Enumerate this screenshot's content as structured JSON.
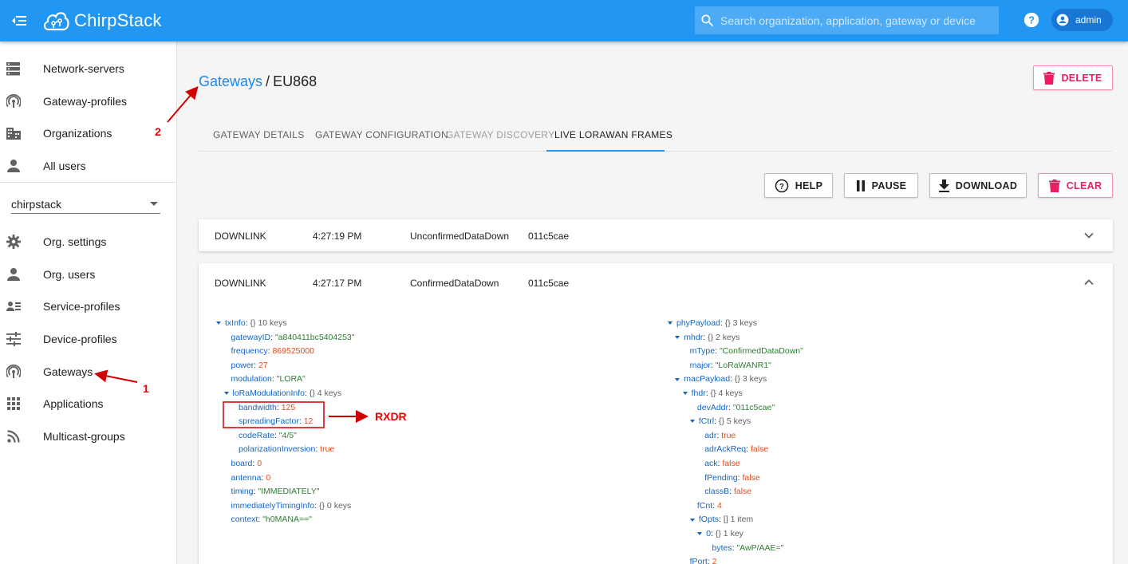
{
  "header": {
    "app_name": "ChirpStack",
    "search_placeholder": "Search organization, application, gateway or device",
    "user": "admin"
  },
  "sidebar": {
    "admin_items": [
      {
        "label": "Network-servers",
        "icon": "server-icon"
      },
      {
        "label": "Gateway-profiles",
        "icon": "antenna-icon"
      },
      {
        "label": "Organizations",
        "icon": "building-icon"
      },
      {
        "label": "All users",
        "icon": "person-icon"
      }
    ],
    "org_selected": "chirpstack",
    "org_items": [
      {
        "label": "Org. settings",
        "icon": "gear-icon"
      },
      {
        "label": "Org. users",
        "icon": "person-icon"
      },
      {
        "label": "Service-profiles",
        "icon": "account-details-icon"
      },
      {
        "label": "Device-profiles",
        "icon": "tune-icon"
      },
      {
        "label": "Gateways",
        "icon": "antenna-icon"
      },
      {
        "label": "Applications",
        "icon": "apps-grid-icon"
      },
      {
        "label": "Multicast-groups",
        "icon": "rss-icon"
      }
    ]
  },
  "breadcrumb": {
    "link": "Gateways",
    "separator": "/",
    "current": "EU868"
  },
  "actions": {
    "delete": "DELETE",
    "help": "HELP",
    "pause": "PAUSE",
    "download": "DOWNLOAD",
    "clear": "CLEAR"
  },
  "tabs": [
    "GATEWAY DETAILS",
    "GATEWAY CONFIGURATION",
    "GATEWAY DISCOVERY",
    "LIVE LORAWAN FRAMES"
  ],
  "active_tab": "LIVE LORAWAN FRAMES",
  "frames": [
    {
      "direction": "DOWNLINK",
      "time": "4:27:19 PM",
      "type": "UnconfirmedDataDown",
      "devaddr": "011c5cae"
    },
    {
      "direction": "DOWNLINK",
      "time": "4:27:17 PM",
      "type": "ConfirmedDataDown",
      "devaddr": "011c5cae"
    }
  ],
  "tree_left": [
    {
      "d": 0,
      "exp": true,
      "k": "txInfo",
      "m": "{}  10 keys"
    },
    {
      "d": 1,
      "k": "gatewayID",
      "v": "\"a840411bc5404253\"",
      "t": "str"
    },
    {
      "d": 1,
      "k": "frequency",
      "v": "869525000",
      "t": "num"
    },
    {
      "d": 1,
      "k": "power",
      "v": "27",
      "t": "num"
    },
    {
      "d": 1,
      "k": "modulation",
      "v": "\"LORA\"",
      "t": "str"
    },
    {
      "d": 1,
      "exp": true,
      "k": "loRaModulationInfo",
      "m": "{}  4 keys"
    },
    {
      "d": 2,
      "k": "bandwidth",
      "v": "125",
      "t": "num"
    },
    {
      "d": 2,
      "k": "spreadingFactor",
      "v": "12",
      "t": "num"
    },
    {
      "d": 2,
      "k": "codeRate",
      "v": "\"4/5\"",
      "t": "str"
    },
    {
      "d": 2,
      "k": "polarizationInversion",
      "v": "true",
      "t": "bool"
    },
    {
      "d": 1,
      "k": "board",
      "v": "0",
      "t": "num"
    },
    {
      "d": 1,
      "k": "antenna",
      "v": "0",
      "t": "num"
    },
    {
      "d": 1,
      "k": "timing",
      "v": "\"IMMEDIATELY\"",
      "t": "str"
    },
    {
      "d": 1,
      "k": "immediatelyTimingInfo",
      "m": "{}  0 keys"
    },
    {
      "d": 1,
      "k": "context",
      "v": "\"h0MANA==\"",
      "t": "str"
    }
  ],
  "tree_right": [
    {
      "d": 0,
      "exp": true,
      "k": "phyPayload",
      "m": "{}  3 keys"
    },
    {
      "d": 1,
      "exp": true,
      "k": "mhdr",
      "m": "{}  2 keys"
    },
    {
      "d": 2,
      "k": "mType",
      "v": "\"ConfirmedDataDown\"",
      "t": "str"
    },
    {
      "d": 2,
      "k": "major",
      "v": "\"LoRaWANR1\"",
      "t": "str"
    },
    {
      "d": 1,
      "exp": true,
      "k": "macPayload",
      "m": "{}  3 keys"
    },
    {
      "d": 2,
      "exp": true,
      "k": "fhdr",
      "m": "{}  4 keys"
    },
    {
      "d": 3,
      "k": "devAddr",
      "v": "\"011c5cae\"",
      "t": "str"
    },
    {
      "d": 3,
      "exp": true,
      "k": "fCtrl",
      "m": "{}  5 keys"
    },
    {
      "d": 4,
      "k": "adr",
      "v": "true",
      "t": "bool"
    },
    {
      "d": 4,
      "k": "adrAckReq",
      "v": "false",
      "t": "bool"
    },
    {
      "d": 4,
      "k": "ack",
      "v": "false",
      "t": "bool"
    },
    {
      "d": 4,
      "k": "fPending",
      "v": "false",
      "t": "bool"
    },
    {
      "d": 4,
      "k": "classB",
      "v": "false",
      "t": "bool"
    },
    {
      "d": 3,
      "k": "fCnt",
      "v": "4",
      "t": "num"
    },
    {
      "d": 3,
      "exp": true,
      "k": "fOpts",
      "m": "[]  1 item"
    },
    {
      "d": 4,
      "exp": true,
      "k": "0",
      "m": "{}  1 key"
    },
    {
      "d": 5,
      "k": "bytes",
      "v": "\"AwP/AAE=\"",
      "t": "str"
    },
    {
      "d": 2,
      "k": "fPort",
      "v": "2",
      "t": "num"
    }
  ],
  "annotations": {
    "arrow1": "1",
    "arrow2": "2",
    "rxdr": "RXDR"
  },
  "colors": {
    "primary": "#2196f3",
    "danger": "#e91e63",
    "annotation": "#e00000"
  }
}
